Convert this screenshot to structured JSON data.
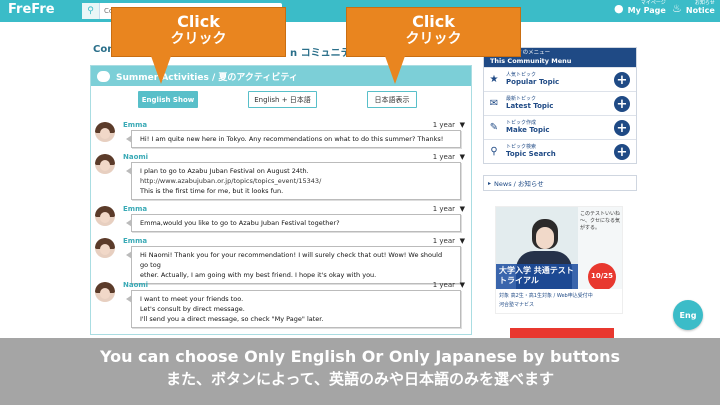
{
  "topbar": {
    "logo": "FreFre",
    "search_placeholder": "Community Search / コミュニティ検索",
    "mypage_small": "マイページ",
    "mypage": "My Page",
    "notice_small": "お知らせ",
    "notice": "Notice"
  },
  "community": {
    "title_left": "Con",
    "title_right": "n コミュニティ"
  },
  "topic": {
    "header": "Summer Activities / 夏のアクティビティ",
    "buttons": [
      "English Show",
      "English + 日本語",
      "日本語表示"
    ]
  },
  "posts": [
    {
      "name": "Emma",
      "time": "1 year",
      "lines": [
        "Hi! I am quite new here in Tokyo. Any recommendations on what to do this summer? Thanks!"
      ]
    },
    {
      "name": "Naomi",
      "time": "1 year",
      "lines": [
        "I plan to go to Azabu Juban Festival on August 24th.",
        "http://www.azabujuban.or.jp/topics/topics_event/15343/",
        "This is the first time for me, but it looks fun."
      ]
    },
    {
      "name": "Emma",
      "time": "1 year",
      "lines": [
        "Emma,would you like to go to Azabu Juban Festival together?"
      ]
    },
    {
      "name": "Emma",
      "time": "1 year",
      "lines": [
        "Hi Naomi! Thank you for your recommendation! I will surely check that out! Wow! We should go tog",
        "ether. Actually, I am going with my best friend. I hope it's okay with you."
      ]
    },
    {
      "name": "Naomi",
      "time": "1 year",
      "lines": [
        "I want to meet your friends too.",
        "Let's consult by direct message.",
        "I'll send you a direct message, so check \"My Page\" later."
      ]
    }
  ],
  "sidebar": {
    "menu_jp": "コミュニティのメニュー",
    "menu_en": "This Community Menu",
    "items": [
      {
        "jp": "人気トピック",
        "en": "Popular Topic",
        "icon": "star-icon"
      },
      {
        "jp": "最新トピック",
        "en": "Latest Topic",
        "icon": "chat-bubbles-icon"
      },
      {
        "jp": "トピック作成",
        "en": "Make Topic",
        "icon": "pencil-icon"
      },
      {
        "jp": "トピック検索",
        "en": "Topic Search",
        "icon": "magnifier-icon"
      }
    ],
    "news": "News / お知らせ"
  },
  "ad": {
    "top_text": "このテストいいね～、クセになる気がする。",
    "headline": "大学入学 共通テストトライアル",
    "date": "10/25",
    "bottom1": "対象 高2生・高1生対象 / Web申込受付中",
    "bottom2": "河合塾マナビス"
  },
  "eng_button": "Eng",
  "callouts": [
    {
      "en": "Click",
      "jp": "クリック"
    },
    {
      "en": "Click",
      "jp": "クリック"
    }
  ],
  "caption": {
    "line1": "You can choose Only English Or Only Japanese by buttons",
    "line2": "また、ボタンによって、英語のみや日本語のみを選べます"
  }
}
